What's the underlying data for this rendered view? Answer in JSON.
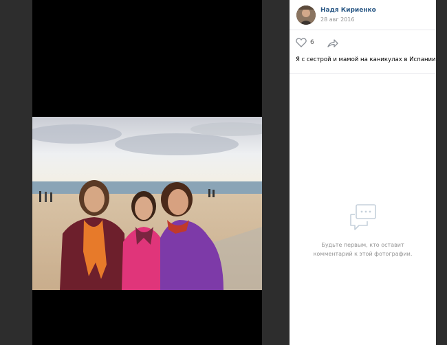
{
  "author": {
    "name": "Надя Кириенко",
    "date": "28 авг 2016",
    "avatar_icon": "user-avatar"
  },
  "actions": {
    "like_icon": "heart-outline-icon",
    "like_count": "6",
    "share_icon": "share-arrow-icon"
  },
  "caption": "Я с сестрой и мамой на каникулах в Испании",
  "comments": {
    "empty_icon": "comment-bubble-icon",
    "empty_line1": "Будьте первым, кто оставит",
    "empty_line2": "комментарий к этой фотографии."
  },
  "colors": {
    "link": "#2a5885",
    "muted": "#939393",
    "backdrop": "#2d2d2d"
  }
}
